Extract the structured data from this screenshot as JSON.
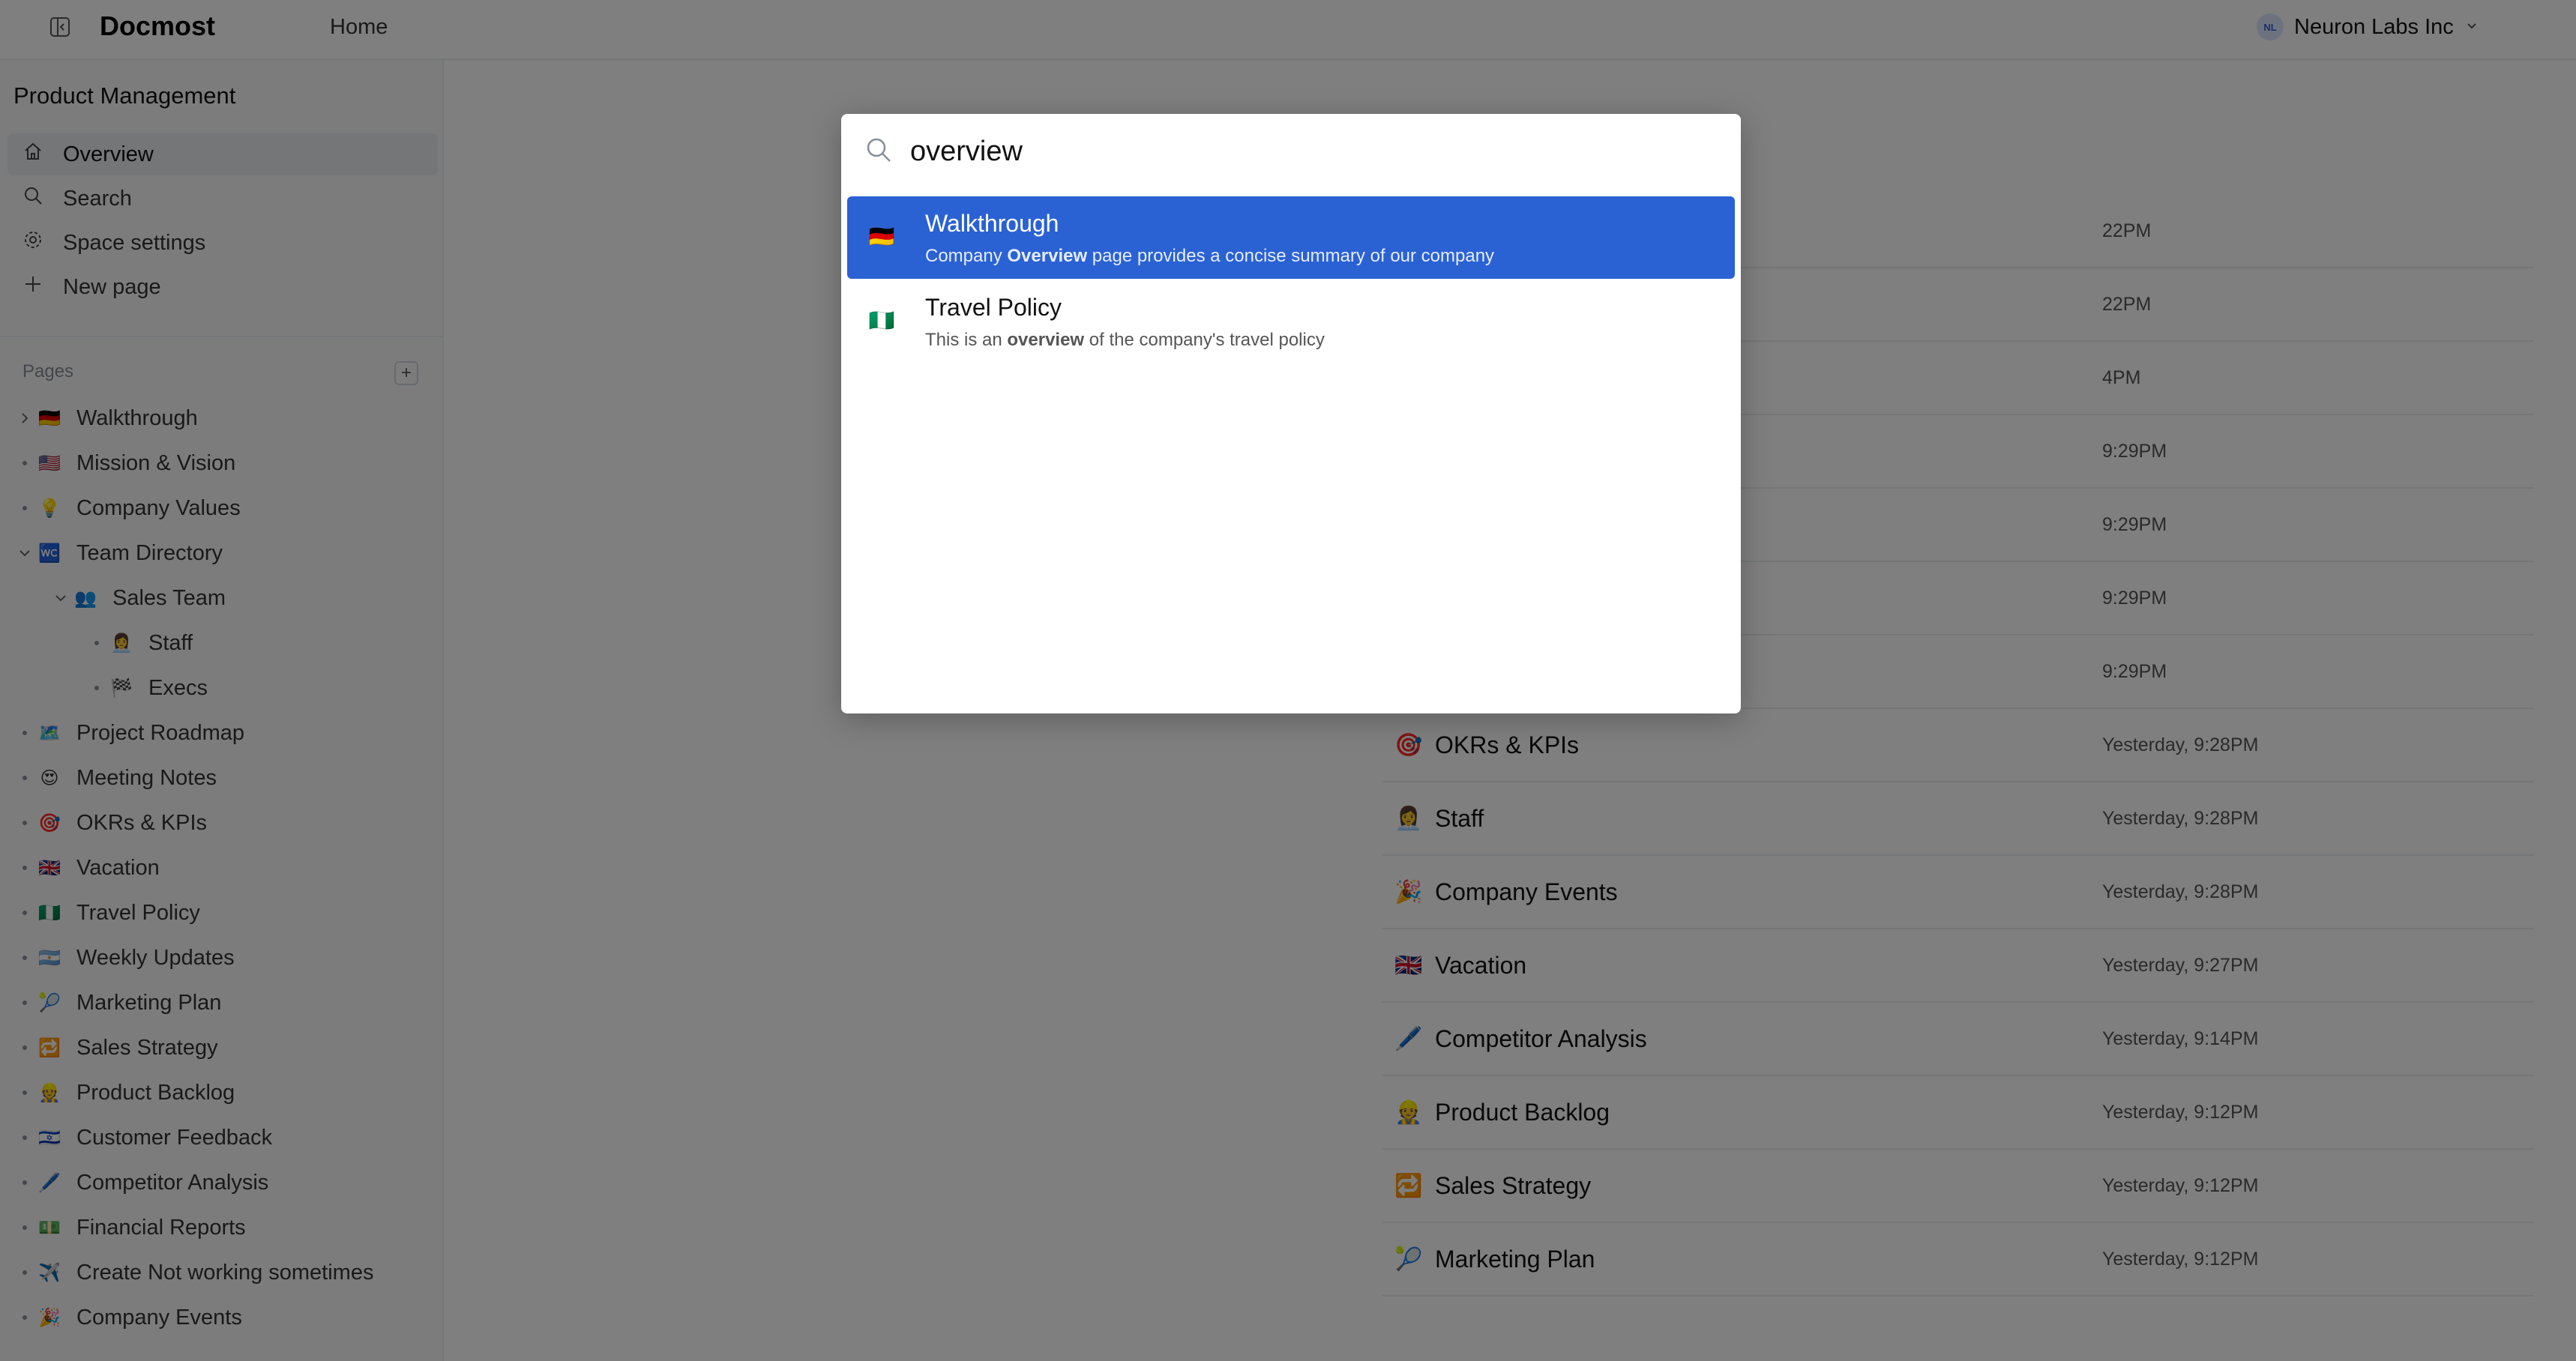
{
  "header": {
    "brand": "Docmost",
    "nav_home": "Home",
    "workspace_initials": "NL",
    "workspace_name": "Neuron Labs Inc"
  },
  "sidebar": {
    "space_name": "Product Management",
    "menu": [
      {
        "label": "Overview",
        "icon": "home-icon"
      },
      {
        "label": "Search",
        "icon": "search-icon"
      },
      {
        "label": "Space settings",
        "icon": "gear-icon"
      },
      {
        "label": "New page",
        "icon": "plus-icon"
      }
    ],
    "pages_label": "Pages",
    "pages": [
      {
        "label": "Walkthrough",
        "emoji": "🇩🇪",
        "depth": 0,
        "marker": "chevron-right"
      },
      {
        "label": "Mission & Vision",
        "emoji": "🇺🇸",
        "depth": 0,
        "marker": "dot"
      },
      {
        "label": "Company Values",
        "emoji": "💡",
        "depth": 0,
        "marker": "dot"
      },
      {
        "label": "Team Directory",
        "emoji": "🚾",
        "depth": 0,
        "marker": "chevron-down"
      },
      {
        "label": "Sales Team",
        "emoji": "👥",
        "depth": 1,
        "marker": "chevron-down"
      },
      {
        "label": "Staff",
        "emoji": "👩‍💼",
        "depth": 2,
        "marker": "dot"
      },
      {
        "label": "Execs",
        "emoji": "🏁",
        "depth": 2,
        "marker": "dot"
      },
      {
        "label": "Project Roadmap",
        "emoji": "🗺️",
        "depth": 0,
        "marker": "dot"
      },
      {
        "label": "Meeting Notes",
        "emoji": "😍",
        "depth": 0,
        "marker": "dot"
      },
      {
        "label": "OKRs & KPIs",
        "emoji": "🎯",
        "depth": 0,
        "marker": "dot"
      },
      {
        "label": "Vacation",
        "emoji": "🇬🇧",
        "depth": 0,
        "marker": "dot"
      },
      {
        "label": "Travel Policy",
        "emoji": "🇳🇬",
        "depth": 0,
        "marker": "dot"
      },
      {
        "label": "Weekly Updates",
        "emoji": "🇦🇷",
        "depth": 0,
        "marker": "dot"
      },
      {
        "label": "Marketing Plan",
        "emoji": "🎾",
        "depth": 0,
        "marker": "dot"
      },
      {
        "label": "Sales Strategy",
        "emoji": "🔁",
        "depth": 0,
        "marker": "dot"
      },
      {
        "label": "Product Backlog",
        "emoji": "👷",
        "depth": 0,
        "marker": "dot"
      },
      {
        "label": "Customer Feedback",
        "emoji": "🇮🇱",
        "depth": 0,
        "marker": "dot"
      },
      {
        "label": "Competitor Analysis",
        "emoji": "🖊️",
        "depth": 0,
        "marker": "dot"
      },
      {
        "label": "Financial Reports",
        "emoji": "💵",
        "depth": 0,
        "marker": "dot"
      },
      {
        "label": "Create Not working sometimes",
        "emoji": "✈️",
        "depth": 0,
        "marker": "dot"
      },
      {
        "label": "Company Events",
        "emoji": "🎉",
        "depth": 0,
        "marker": "dot"
      }
    ]
  },
  "recent": [
    {
      "emoji": "",
      "title": "",
      "time": "22PM"
    },
    {
      "emoji": "",
      "title": "",
      "time": "22PM"
    },
    {
      "emoji": "",
      "title": "",
      "time": "4PM"
    },
    {
      "emoji": "",
      "title": "",
      "time": "9:29PM"
    },
    {
      "emoji": "",
      "title": "",
      "time": "9:29PM"
    },
    {
      "emoji": "",
      "title": "",
      "time": "9:29PM"
    },
    {
      "emoji": "",
      "title": "",
      "time": "9:29PM"
    },
    {
      "emoji": "🎯",
      "title": "OKRs & KPIs",
      "time": "Yesterday, 9:28PM"
    },
    {
      "emoji": "👩‍💼",
      "title": "Staff",
      "time": "Yesterday, 9:28PM"
    },
    {
      "emoji": "🎉",
      "title": "Company Events",
      "time": "Yesterday, 9:28PM"
    },
    {
      "emoji": "🇬🇧",
      "title": "Vacation",
      "time": "Yesterday, 9:27PM"
    },
    {
      "emoji": "🖊️",
      "title": "Competitor Analysis",
      "time": "Yesterday, 9:14PM"
    },
    {
      "emoji": "👷",
      "title": "Product Backlog",
      "time": "Yesterday, 9:12PM"
    },
    {
      "emoji": "🔁",
      "title": "Sales Strategy",
      "time": "Yesterday, 9:12PM"
    },
    {
      "emoji": "🎾",
      "title": "Marketing Plan",
      "time": "Yesterday, 9:12PM"
    }
  ],
  "spotlight": {
    "query": "overview",
    "results": [
      {
        "title": "Walkthrough",
        "emoji": "🇩🇪",
        "desc_before": "Company ",
        "desc_highlight": "Overview",
        "desc_after": " page provides a concise summary of our company",
        "selected": true
      },
      {
        "title": "Travel Policy",
        "emoji": "🇳🇬",
        "desc_before": "This is an ",
        "desc_highlight": "overview",
        "desc_after": " of the company's travel policy",
        "selected": false
      }
    ]
  }
}
